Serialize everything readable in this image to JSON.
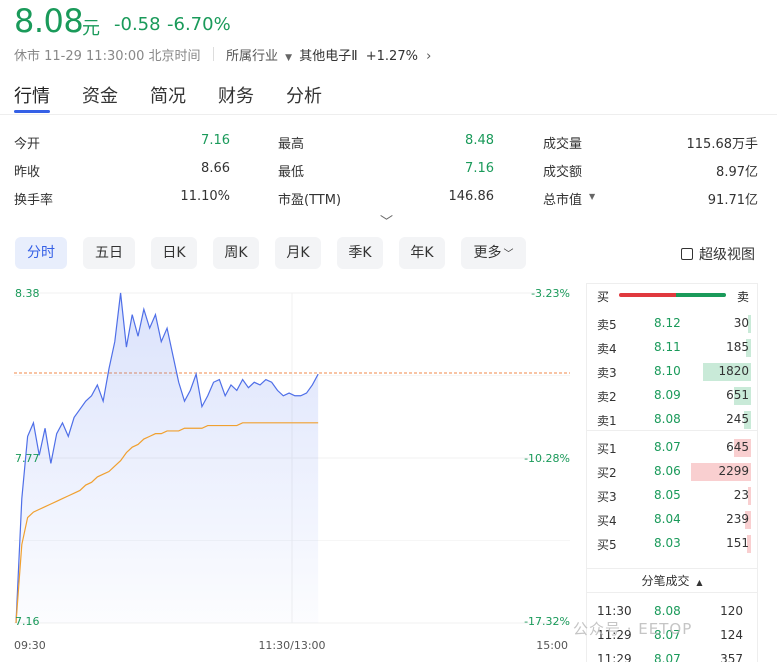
{
  "quote": {
    "price": "8.08",
    "unit": "元",
    "change": "-0.58",
    "change_pct": "-6.70%",
    "status": "休市 11-29 11:30:00 北京时间",
    "industry_label": "所属行业",
    "industry_name": "其他电子Ⅱ",
    "industry_change": "+1.27%"
  },
  "tabs": [
    "行情",
    "资金",
    "简况",
    "财务",
    "分析"
  ],
  "stats": [
    {
      "label": "今开",
      "value": "7.16",
      "color": "green"
    },
    {
      "label": "最高",
      "value": "8.48",
      "color": "green"
    },
    {
      "label": "成交量",
      "value": "115.68万手",
      "color": "dark"
    },
    {
      "label": "昨收",
      "value": "8.66",
      "color": "dark"
    },
    {
      "label": "最低",
      "value": "7.16",
      "color": "green"
    },
    {
      "label": "成交额",
      "value": "8.97亿",
      "color": "dark"
    },
    {
      "label": "换手率",
      "value": "11.10%",
      "color": "dark"
    },
    {
      "label": "市盈(TTM)",
      "value": "146.86",
      "color": "dark"
    },
    {
      "label": "总市值",
      "value": "91.71亿",
      "color": "dark"
    }
  ],
  "periods": [
    "分时",
    "五日",
    "日K",
    "周K",
    "月K",
    "季K",
    "年K",
    "更多"
  ],
  "super_view": "超级视图",
  "chart": {
    "y_left": [
      "8.38",
      "7.77",
      "7.16"
    ],
    "y_right": [
      "-3.23%",
      "-10.28%",
      "-17.32%"
    ],
    "x_labels": [
      "09:30",
      "11:30/13:00",
      "15:00"
    ],
    "prev_close": 8.66,
    "price_min": 7.16,
    "price_max": 8.38,
    "price_series": [
      7.16,
      7.62,
      7.85,
      7.9,
      7.78,
      7.88,
      7.75,
      7.86,
      7.9,
      7.85,
      7.92,
      7.95,
      7.98,
      8.0,
      8.04,
      7.98,
      8.1,
      8.2,
      8.38,
      8.18,
      8.3,
      8.22,
      8.32,
      8.25,
      8.3,
      8.2,
      8.25,
      8.15,
      8.05,
      7.98,
      8.02,
      8.08,
      7.96,
      8.0,
      8.05,
      8.06,
      8.0,
      8.04,
      8.02,
      8.06,
      8.03,
      8.05,
      8.04,
      8.06,
      8.05,
      8.02,
      8.0,
      8.01,
      8.0,
      8.0,
      8.01,
      8.04,
      8.08
    ],
    "avg_series": [
      7.16,
      7.45,
      7.55,
      7.57,
      7.58,
      7.59,
      7.6,
      7.61,
      7.62,
      7.63,
      7.64,
      7.65,
      7.67,
      7.68,
      7.7,
      7.71,
      7.72,
      7.74,
      7.76,
      7.79,
      7.81,
      7.82,
      7.84,
      7.85,
      7.86,
      7.86,
      7.87,
      7.87,
      7.87,
      7.88,
      7.88,
      7.88,
      7.88,
      7.89,
      7.89,
      7.89,
      7.89,
      7.89,
      7.89,
      7.9,
      7.9,
      7.9,
      7.9,
      7.9,
      7.9,
      7.9,
      7.9,
      7.9,
      7.9,
      7.9,
      7.9,
      7.9,
      7.9
    ],
    "total_points": 96
  },
  "orderbook": {
    "buy_label": "买",
    "sell_label": "卖",
    "sells": [
      {
        "label": "卖5",
        "price": "8.12",
        "vol": "30",
        "pct": 0.02
      },
      {
        "label": "卖4",
        "price": "8.11",
        "vol": "185",
        "pct": 0.08
      },
      {
        "label": "卖3",
        "price": "8.10",
        "vol": "1820",
        "pct": 0.8
      },
      {
        "label": "卖2",
        "price": "8.09",
        "vol": "651",
        "pct": 0.29
      },
      {
        "label": "卖1",
        "price": "8.08",
        "vol": "245",
        "pct": 0.11
      }
    ],
    "buys": [
      {
        "label": "买1",
        "price": "8.07",
        "vol": "645",
        "pct": 0.28
      },
      {
        "label": "买2",
        "price": "8.06",
        "vol": "2299",
        "pct": 1.0
      },
      {
        "label": "买3",
        "price": "8.05",
        "vol": "23",
        "pct": 0.01
      },
      {
        "label": "买4",
        "price": "8.04",
        "vol": "239",
        "pct": 0.1
      },
      {
        "label": "买5",
        "price": "8.03",
        "vol": "151",
        "pct": 0.07
      }
    ],
    "trades_title": "分笔成交",
    "trades": [
      {
        "time": "11:30",
        "price": "8.08",
        "vol": "120"
      },
      {
        "time": "11:29",
        "price": "8.07",
        "vol": "124"
      },
      {
        "time": "11:29",
        "price": "8.07",
        "vol": "357"
      }
    ]
  },
  "watermark": "公众号 · EETOP",
  "colors": {
    "green": "#1a9a5a",
    "red": "#e0393e",
    "blue": "#3560e6",
    "orange": "#f0a030"
  }
}
